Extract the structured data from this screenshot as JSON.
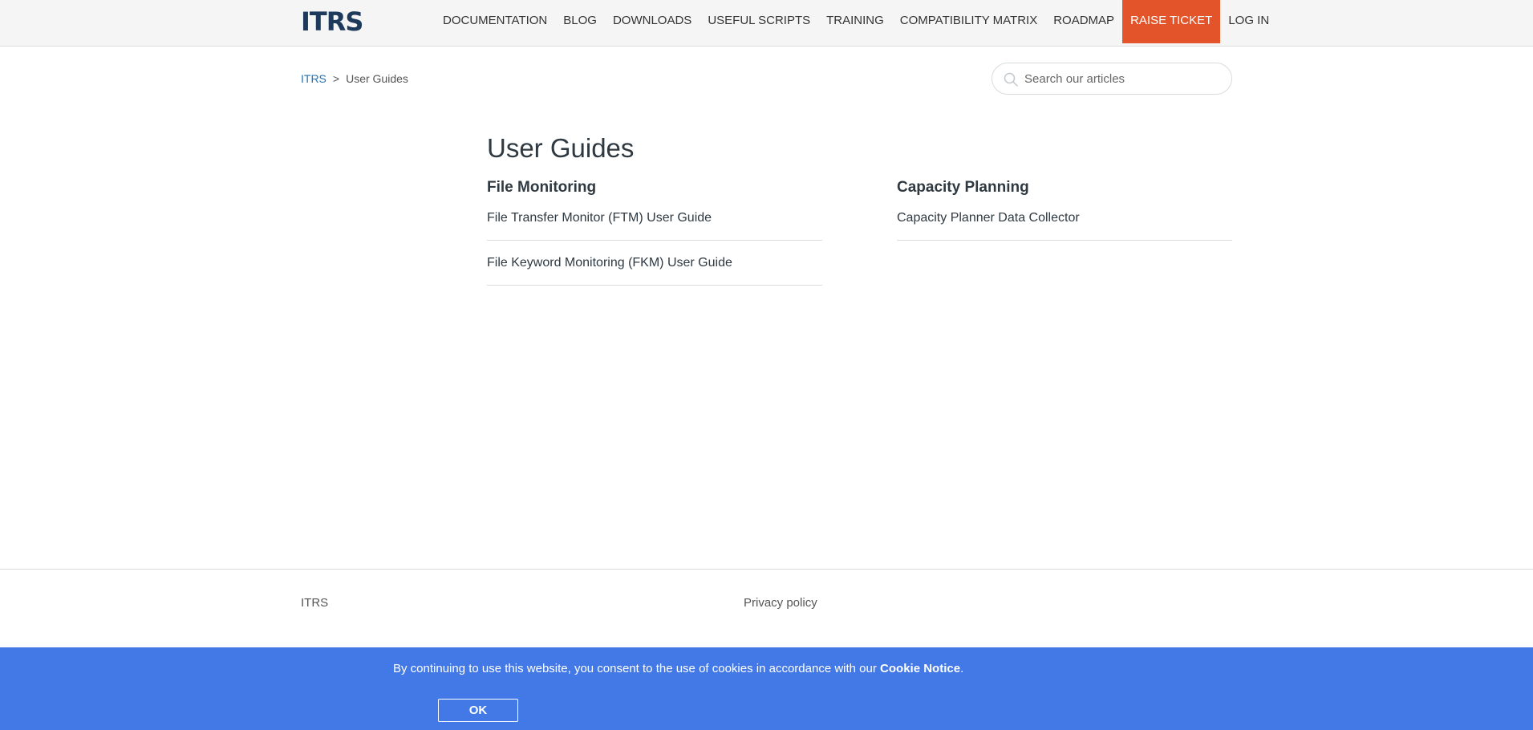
{
  "header": {
    "logo_text": "ITRS",
    "nav": [
      {
        "label": "DOCUMENTATION"
      },
      {
        "label": "BLOG"
      },
      {
        "label": "DOWNLOADS"
      },
      {
        "label": "USEFUL SCRIPTS"
      },
      {
        "label": "TRAINING"
      },
      {
        "label": "COMPATIBILITY MATRIX"
      },
      {
        "label": "ROADMAP"
      },
      {
        "label": "RAISE TICKET"
      },
      {
        "label": "LOG IN"
      }
    ],
    "accent_color": "#e3542a"
  },
  "breadcrumb": {
    "root": "ITRS",
    "separator": ">",
    "current": "User Guides"
  },
  "search": {
    "placeholder": "Search our articles",
    "value": ""
  },
  "main": {
    "title": "User Guides",
    "sections": [
      {
        "heading": "File Monitoring",
        "articles": [
          "File Transfer Monitor (FTM) User Guide",
          "File Keyword Monitoring (FKM) User Guide"
        ]
      },
      {
        "heading": "Capacity Planning",
        "articles": [
          "Capacity Planner Data Collector"
        ]
      }
    ]
  },
  "footer": {
    "brand": "ITRS",
    "privacy": "Privacy policy"
  },
  "cookie_banner": {
    "text_before": "By continuing to use this website, you consent to the use of cookies in accordance with our ",
    "link": "Cookie Notice",
    "text_after": ".",
    "ok_label": "OK",
    "background_color": "#4379e6"
  }
}
